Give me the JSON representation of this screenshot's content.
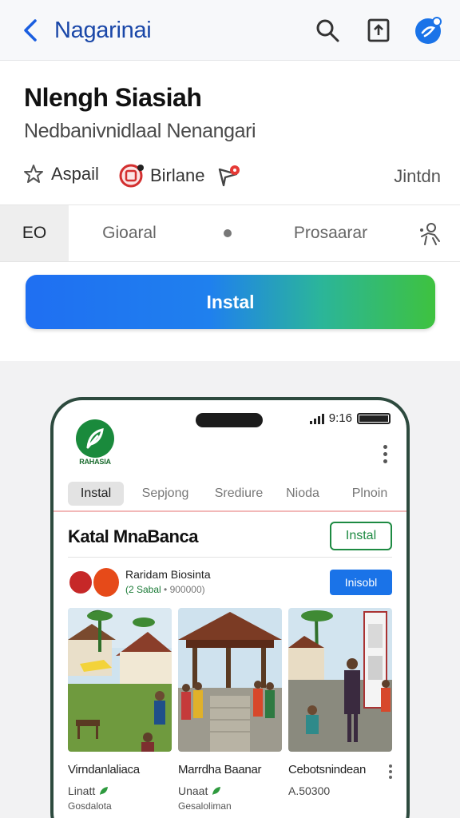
{
  "topbar": {
    "title": "Nagarinai",
    "icons": [
      "back-arrow-icon",
      "search-icon",
      "share-box-icon",
      "account-icon"
    ]
  },
  "app": {
    "title": "Nlengh Siasiah",
    "subtitle": "Nedbanivnidlaal Nenangari",
    "rating_label": "Aspail",
    "brand_label": "Birlane",
    "right_label": "Jintdn"
  },
  "tabs": {
    "first": "EO",
    "second": "Gioaral",
    "third": "Prosaarar"
  },
  "install": {
    "label": "Instal"
  },
  "preview": {
    "status_time": "9:16",
    "logo_text": "RAHASIA",
    "tabs": [
      "Instal",
      "Sepjong",
      "Srediure",
      "Nioda",
      "Plnoin"
    ],
    "title": "Katal MnaBanca",
    "install_outline_label": "Instal",
    "developer": {
      "name": "Raridam Biosinta",
      "rating": "(2 Sabal",
      "rating_extra": "• 900000)",
      "install_label": "Inisobl"
    },
    "cards": [
      {
        "title": "Virndanlaliaca",
        "sub": "Linatt",
        "sub2": "Gosdalota"
      },
      {
        "title": "Marrdha Baanar",
        "sub": "Unaat",
        "sub2": "Gesaloliman"
      },
      {
        "title": "Cebotsnindean",
        "sub": "A.50300",
        "sub2": ""
      }
    ]
  },
  "colors": {
    "accent_blue": "#1a73e8",
    "accent_green": "#1d8a42",
    "title_blue": "#1a47a8"
  }
}
